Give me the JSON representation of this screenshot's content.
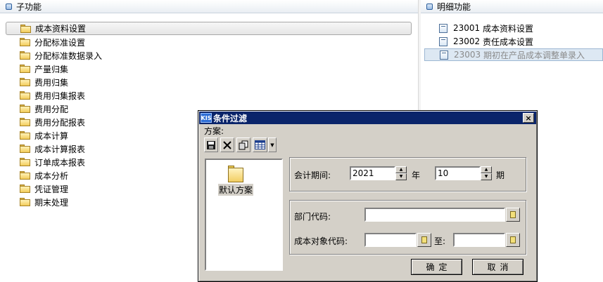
{
  "left_panel": {
    "header": "子功能",
    "root_item": "成本资料设置",
    "items": [
      "分配标准设置",
      "分配标准数据录入",
      "产量归集",
      "费用归集",
      "费用归集报表",
      "费用分配",
      "费用分配报表",
      "成本计算",
      "成本计算报表",
      "订单成本报表",
      "成本分析",
      "凭证管理",
      "期末处理"
    ]
  },
  "right_panel": {
    "header": "明细功能",
    "items": [
      {
        "code": "23001",
        "name": "成本资料设置"
      },
      {
        "code": "23002",
        "name": "责任成本设置"
      },
      {
        "code": "23003",
        "name": "期初在产品成本调整单录入"
      }
    ]
  },
  "dialog": {
    "title": "条件过滤",
    "app_badge": "KIS",
    "close": "×",
    "scheme_label": "方案:",
    "scheme_name": "默认方案",
    "period_label": "会计期间:",
    "year_value": "2021",
    "year_unit": "年",
    "period_value": "10",
    "period_unit": "期",
    "dept_label": "部门代码:",
    "dept_value": "",
    "cost_obj_label": "成本对象代码:",
    "cost_obj_from": "",
    "to_label": "至:",
    "cost_obj_to": "",
    "ok_label": "确定",
    "cancel_label": "取消"
  },
  "icons": [
    "folder-icon",
    "document-icon",
    "save-icon",
    "delete-icon",
    "copy-icon",
    "table-icon",
    "dropdown-arrow-icon",
    "lookup-icon",
    "spin-up-icon",
    "spin-down-icon"
  ],
  "colors": {
    "titlebar": "#0a246a",
    "selection": "#dde8f3",
    "dialog_face": "#d4d0c8"
  }
}
